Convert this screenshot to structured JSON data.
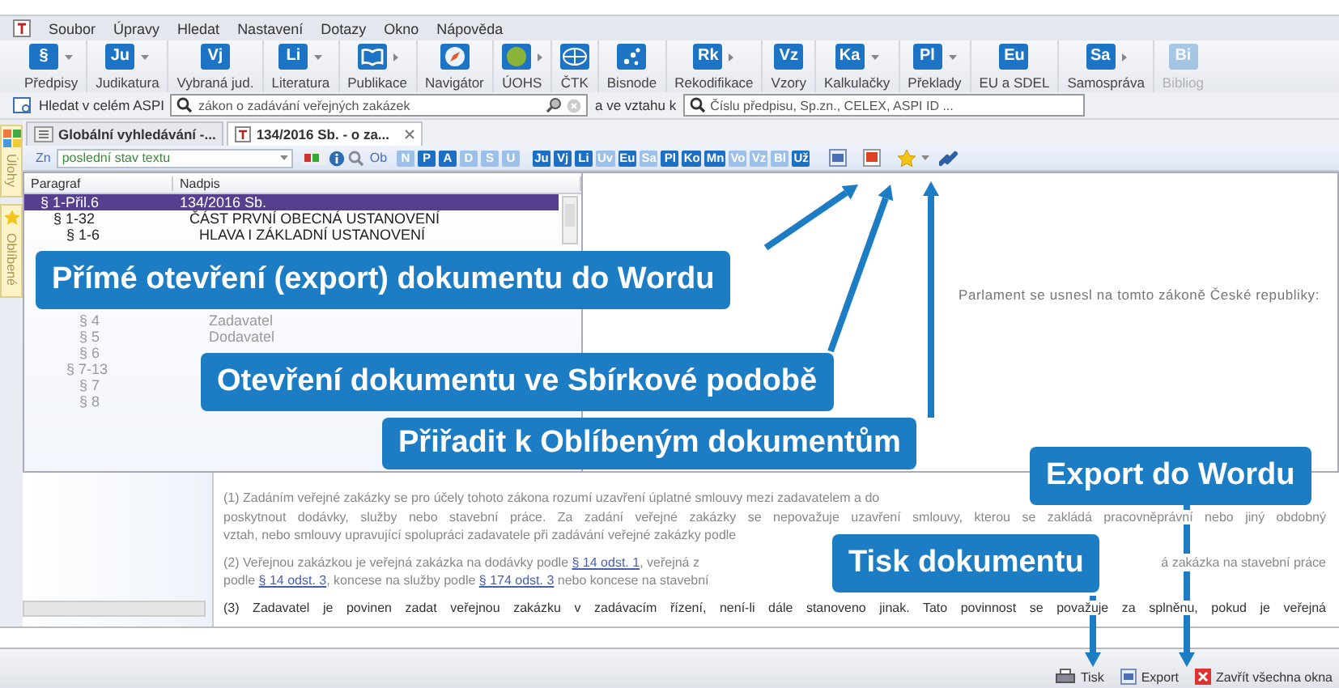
{
  "menu": [
    "Soubor",
    "Úpravy",
    "Hledat",
    "Nastavení",
    "Dotazy",
    "Okno",
    "Nápověda"
  ],
  "ribbon": [
    {
      "kind": "letters",
      "icon_text": "§",
      "label": "Předpisy",
      "dropdown": true,
      "submenu": false,
      "disabled": false
    },
    {
      "kind": "letters",
      "icon_text": "Ju",
      "label": "Judikatura",
      "dropdown": true,
      "submenu": false,
      "disabled": false
    },
    {
      "kind": "letters",
      "icon_text": "Vj",
      "label": "Vybraná jud.",
      "dropdown": false,
      "submenu": false,
      "disabled": false
    },
    {
      "kind": "letters",
      "icon_text": "Li",
      "label": "Literatura",
      "dropdown": true,
      "submenu": false,
      "disabled": false
    },
    {
      "kind": "book",
      "label": "Publikace",
      "dropdown": false,
      "submenu": true,
      "disabled": false
    },
    {
      "kind": "compass",
      "label": "Navigátor",
      "dropdown": false,
      "submenu": false,
      "disabled": false
    },
    {
      "kind": "badge",
      "label": "ÚOHS",
      "dropdown": false,
      "submenu": true,
      "disabled": false
    },
    {
      "kind": "globe",
      "label": "ČTK",
      "dropdown": false,
      "submenu": false,
      "disabled": false
    },
    {
      "kind": "network",
      "label": "Bisnode",
      "dropdown": false,
      "submenu": false,
      "disabled": false
    },
    {
      "kind": "letters",
      "icon_text": "Rk",
      "label": "Rekodifikace",
      "dropdown": false,
      "submenu": true,
      "disabled": false
    },
    {
      "kind": "letters",
      "icon_text": "Vz",
      "label": "Vzory",
      "dropdown": false,
      "submenu": false,
      "disabled": false
    },
    {
      "kind": "letters",
      "icon_text": "Ka",
      "label": "Kalkulačky",
      "dropdown": true,
      "submenu": false,
      "disabled": false
    },
    {
      "kind": "letters",
      "icon_text": "Pl",
      "label": "Překlady",
      "dropdown": true,
      "submenu": false,
      "disabled": false
    },
    {
      "kind": "letters",
      "icon_text": "Eu",
      "label": "EU a SDEL",
      "dropdown": false,
      "submenu": false,
      "disabled": false
    },
    {
      "kind": "letters",
      "icon_text": "Sa",
      "label": "Samospráva",
      "dropdown": false,
      "submenu": true,
      "disabled": false
    },
    {
      "kind": "letters",
      "icon_text": "Bi",
      "label": "Bibliog",
      "dropdown": false,
      "submenu": false,
      "disabled": true
    }
  ],
  "search": {
    "scope_label": "Hledat v celém ASPI",
    "value": "zákon o zadávání veřejných zakázek",
    "relation_label": "a ve vztahu k",
    "relation_placeholder": "Číslu předpisu, Sp.zn., CELEX, ASPI ID ..."
  },
  "sidebar": [
    {
      "label": "Úlohy"
    },
    {
      "label": "Oblíbené"
    }
  ],
  "tabs": [
    {
      "label": "Globální vyhledávání -...",
      "selected": false,
      "closable": false
    },
    {
      "label": "134/2016 Sb. - o za...",
      "selected": true,
      "closable": true
    }
  ],
  "toolbar": {
    "version_label": "Zn",
    "version_value": "poslední stav textu",
    "ob_label": "Ob",
    "parts": [
      {
        "text": "N",
        "active": false
      },
      {
        "text": "P",
        "active": true
      },
      {
        "text": "A",
        "active": true
      },
      {
        "text": "D",
        "active": false
      },
      {
        "text": "S",
        "active": false
      },
      {
        "text": "U",
        "active": false
      }
    ],
    "sources": [
      {
        "text": "Ju",
        "active": true
      },
      {
        "text": "Vj",
        "active": true
      },
      {
        "text": "Li",
        "active": true
      },
      {
        "text": "Uv",
        "active": false
      },
      {
        "text": "Eu",
        "active": true
      },
      {
        "text": "Sa",
        "active": false
      },
      {
        "text": "Pl",
        "active": true
      },
      {
        "text": "Ko",
        "active": true
      },
      {
        "text": "Mn",
        "active": true
      },
      {
        "text": "Vo",
        "active": false
      },
      {
        "text": "Vz",
        "active": false
      },
      {
        "text": "Bl",
        "active": false
      },
      {
        "text": "Už",
        "active": true
      }
    ]
  },
  "outline": {
    "columns": [
      "Paragraf",
      "Nadpis"
    ],
    "rows": [
      {
        "paragraph": "§ 1-Přil.6",
        "title": "134/2016 Sb.",
        "selected": true,
        "children": [
          {
            "paragraph": "§ 1-32",
            "title": "ČÁST PRVNÍ OBECNÁ USTANOVENÍ",
            "selected": false,
            "children": [
              {
                "paragraph": "§ 1-6",
                "title": "HLAVA I ZÁKLADNÍ USTANOVENÍ",
                "selected": false,
                "children": [
                  {
                    "paragraph": "§ 4",
                    "title": "Zadavatel",
                    "selected": false
                  },
                  {
                    "paragraph": "§ 5",
                    "title": "Dodavatel",
                    "selected": false
                  },
                  {
                    "paragraph": "§ 6",
                    "selected": false
                  }
                ]
              },
              {
                "paragraph": "§ 7-13",
                "selected": false,
                "children": [
                  {
                    "paragraph": "§ 7",
                    "selected": false
                  },
                  {
                    "paragraph": "§ 8",
                    "selected": false
                  }
                ]
              }
            ]
          }
        ]
      }
    ]
  },
  "document": {
    "preamble": "Parlament se usnesl na tomto zákoně České republiky:",
    "paragraphs": [
      {
        "bold": false,
        "lines": [
          {
            "covered": true,
            "segments": [
              [
                {
                  "kind": "text",
                  "text": "(1) Zadáním veřejné zakázky se pro účely tohoto zákona rozumí uzavření úplatné smlouvy mezi zadavatelem a do"
                }
              ]
            ]
          },
          {
            "covered": false,
            "segments": [
              [
                {
                  "kind": "text",
                  "text": "poskytnout dodávky, služby nebo stavební práce. Za zadání veřejné zakázky se nepovažuje uzavření smlouvy, kterou se zakládá pracovněprávní nebo jiný obdobný"
                }
              ]
            ]
          },
          {
            "covered": true,
            "segments": [
              [
                {
                  "kind": "text",
                  "text": "vztah, nebo smlouvy upravující spolupráci zadavatele při zadávání veřejné zakázky podle"
                }
              ]
            ]
          }
        ]
      },
      {
        "bold": false,
        "lines": [
          {
            "segments": [
              [
                {
                  "kind": "text",
                  "text": "(2) Veřejnou zakázkou je veřejná zakázka na dodávky podle "
                },
                {
                  "kind": "link",
                  "text": "§ 14 odst. 1"
                },
                {
                  "kind": "text",
                  "text": ", veřejná z"
                }
              ],
              [
                {
                  "kind": "text",
                  "text": "á zakázka na stavební práce"
                }
              ]
            ]
          },
          {
            "covered": true,
            "segments": [
              [
                {
                  "kind": "text",
                  "text": "podle "
                },
                {
                  "kind": "link",
                  "text": "§ 14 odst. 3"
                },
                {
                  "kind": "text",
                  "text": ", koncese na služby podle "
                },
                {
                  "kind": "link",
                  "text": "§ 174 odst. 3"
                },
                {
                  "kind": "text",
                  "text": " nebo koncese na stavební"
                }
              ]
            ]
          }
        ]
      },
      {
        "bold": true,
        "lines": [
          {
            "covered": false,
            "segments": [
              [
                {
                  "kind": "text",
                  "text": "(3) Zadavatel je povinen zadat veřejnou zakázku v zadávacím řízení, není-li dále stanoveno jinak. Tato povinnost se považuje za splněnu, pokud je veřejná"
                }
              ]
            ]
          }
        ]
      }
    ]
  },
  "status_bar": [
    {
      "kind": "print",
      "label": "Tisk"
    },
    {
      "kind": "word",
      "label": "Export"
    },
    {
      "kind": "close",
      "label": "Zavřít všechna okna"
    }
  ],
  "callouts": [
    {
      "text": "Přímé otevření (export) dokumentu do Wordu"
    },
    {
      "text": "Otevření dokumentu ve Sbírkové podobě"
    },
    {
      "text": "Přiřadit k Oblíbeným dokumentům"
    },
    {
      "text": "Export do Wordu"
    },
    {
      "text": "Tisk dokumentu"
    }
  ]
}
